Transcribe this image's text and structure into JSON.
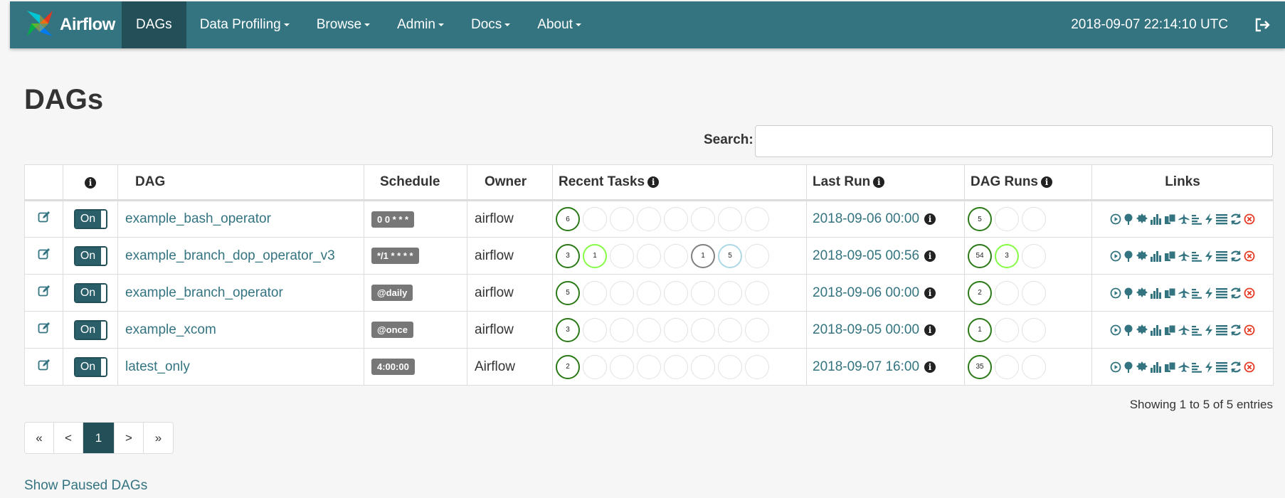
{
  "colors": {
    "navbar": "#347481",
    "navbar_active": "#234f58",
    "link": "#347481",
    "success": "#2b7a17",
    "up_for_retry": "#85fc45",
    "skipped": "#e2e2e2",
    "upstream_failed": "#808080",
    "queued": "#add8e6",
    "failed": "#ff0000"
  },
  "navbar": {
    "brand": "Airflow",
    "items": [
      {
        "label": "DAGs",
        "active": true
      },
      {
        "label": "Data Profiling"
      },
      {
        "label": "Browse"
      },
      {
        "label": "Admin"
      },
      {
        "label": "Docs"
      },
      {
        "label": "About"
      }
    ],
    "datetime": "2018-09-07 22:14:10 UTC",
    "logout_icon": "sign-out-icon"
  },
  "page": {
    "title": "DAGs"
  },
  "search": {
    "label": "Search:",
    "value": ""
  },
  "table": {
    "headers": {
      "dag": "DAG",
      "schedule": "Schedule",
      "owner": "Owner",
      "recent_tasks": "Recent Tasks",
      "last_run": "Last Run",
      "dag_runs": "DAG Runs",
      "links": "Links"
    },
    "rows": [
      {
        "toggle": "On",
        "dag": "example_bash_operator",
        "schedule": "0 0 * * *",
        "owner": "airflow",
        "recent_tasks": [
          {
            "n": "6",
            "c": "#2b7a17"
          },
          {},
          {},
          {},
          {},
          {},
          {},
          {}
        ],
        "last_run": "2018-09-06 00:00",
        "dag_runs": [
          {
            "n": "5",
            "c": "#2b7a17"
          },
          {},
          {}
        ]
      },
      {
        "toggle": "On",
        "dag": "example_branch_dop_operator_v3",
        "schedule": "*/1 * * * *",
        "owner": "airflow",
        "recent_tasks": [
          {
            "n": "3",
            "c": "#2b7a17"
          },
          {
            "n": "1",
            "c": "#85fc45"
          },
          {},
          {},
          {},
          {
            "n": "1",
            "c": "#808080"
          },
          {
            "n": "5",
            "c": "#add8e6"
          },
          {}
        ],
        "last_run": "2018-09-05 00:56",
        "dag_runs": [
          {
            "n": "54",
            "c": "#2b7a17"
          },
          {
            "n": "3",
            "c": "#85fc45"
          },
          {}
        ]
      },
      {
        "toggle": "On",
        "dag": "example_branch_operator",
        "schedule": "@daily",
        "owner": "airflow",
        "recent_tasks": [
          {
            "n": "5",
            "c": "#2b7a17"
          },
          {},
          {},
          {},
          {},
          {},
          {},
          {}
        ],
        "last_run": "2018-09-06 00:00",
        "dag_runs": [
          {
            "n": "2",
            "c": "#2b7a17"
          },
          {},
          {}
        ]
      },
      {
        "toggle": "On",
        "dag": "example_xcom",
        "schedule": "@once",
        "owner": "airflow",
        "recent_tasks": [
          {
            "n": "3",
            "c": "#2b7a17"
          },
          {},
          {},
          {},
          {},
          {},
          {},
          {}
        ],
        "last_run": "2018-09-05 00:00",
        "dag_runs": [
          {
            "n": "1",
            "c": "#2b7a17"
          },
          {},
          {}
        ]
      },
      {
        "toggle": "On",
        "dag": "latest_only",
        "schedule": "4:00:00",
        "owner": "Airflow",
        "recent_tasks": [
          {
            "n": "2",
            "c": "#2b7a17"
          },
          {},
          {},
          {},
          {},
          {},
          {},
          {}
        ],
        "last_run": "2018-09-07 16:00",
        "dag_runs": [
          {
            "n": "35",
            "c": "#2b7a17"
          },
          {},
          {}
        ]
      }
    ],
    "link_icons": [
      "trigger-dag-icon",
      "tree-view-icon",
      "graph-view-icon",
      "task-duration-icon",
      "task-tries-icon",
      "landing-times-icon",
      "gantt-icon",
      "code-view-icon",
      "logs-icon",
      "refresh-icon",
      "delete-dag-icon"
    ]
  },
  "footer": {
    "showing": "Showing 1 to 5 of 5 entries",
    "pagination": [
      "«",
      "<",
      "1",
      ">",
      "»"
    ],
    "show_paused": "Show Paused DAGs"
  }
}
